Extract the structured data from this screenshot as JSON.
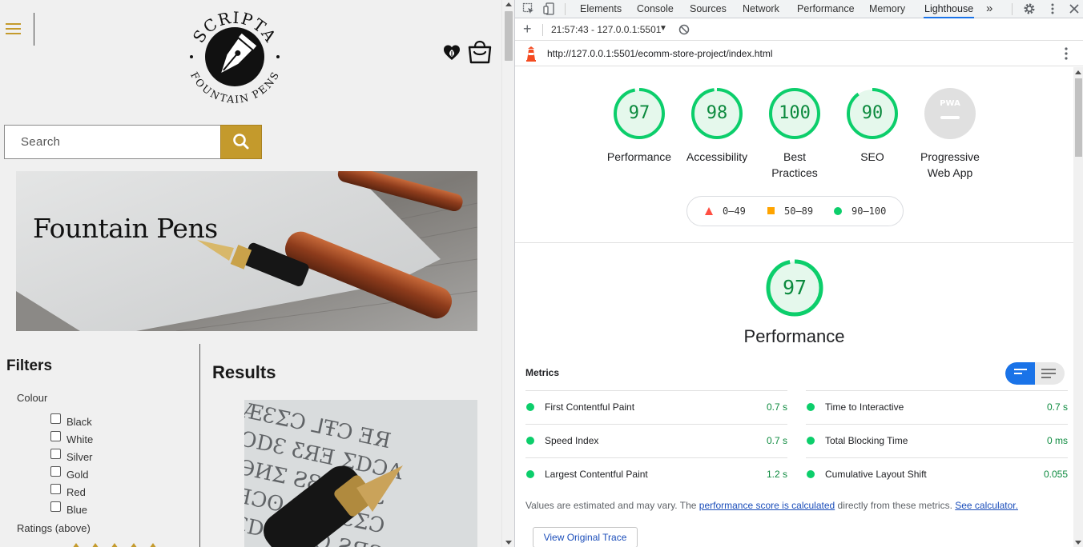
{
  "site": {
    "logo": {
      "top_text": "SCRIPTA",
      "bottom_text": "FOUNTAIN PENS"
    },
    "search": {
      "placeholder": "Search"
    },
    "hero": {
      "title": "Fountain Pens"
    },
    "filters": {
      "title": "Filters",
      "colour_label": "Colour",
      "colours": [
        "Black",
        "White",
        "Silver",
        "Gold",
        "Red",
        "Blue"
      ],
      "ratings_label": "Ratings (above)"
    },
    "results": {
      "title": "Results"
    },
    "colors": {
      "accent": "#c49a2c",
      "background": "#f0f0f0"
    }
  },
  "devtools": {
    "tabs": [
      "Elements",
      "Console",
      "Sources",
      "Network",
      "Performance",
      "Memory",
      "Lighthouse"
    ],
    "active_tab": "Lighthouse",
    "more_tabs": "»",
    "report_selector": "21:57:43 - 127.0.0.1:5501",
    "url": "http://127.0.0.1:5501/ecomm-store-project/index.html",
    "lighthouse": {
      "scores": [
        {
          "label": "Performance",
          "value": "97",
          "score": 97
        },
        {
          "label": "Accessibility",
          "value": "98",
          "score": 98
        },
        {
          "label": "Best Practices",
          "value": "100",
          "score": 100
        },
        {
          "label": "SEO",
          "value": "90",
          "score": 90
        }
      ],
      "pwa": {
        "label": "Progressive Web App",
        "badge": "PWA"
      },
      "legend": [
        {
          "range": "0–49",
          "shape": "triangle",
          "color": "#ff4e42"
        },
        {
          "range": "50–89",
          "shape": "square",
          "color": "#ffa400"
        },
        {
          "range": "90–100",
          "shape": "circle",
          "color": "#0cce6b"
        }
      ],
      "performance": {
        "score": "97",
        "title": "Performance",
        "metrics_title": "Metrics",
        "metrics": [
          {
            "name": "First Contentful Paint",
            "value": "0.7 s"
          },
          {
            "name": "Time to Interactive",
            "value": "0.7 s"
          },
          {
            "name": "Speed Index",
            "value": "0.7 s"
          },
          {
            "name": "Total Blocking Time",
            "value": "0 ms"
          },
          {
            "name": "Largest Contentful Paint",
            "value": "1.2 s"
          },
          {
            "name": "Cumulative Layout Shift",
            "value": "0.055"
          }
        ],
        "note_prefix": "Values are estimated and may vary. The ",
        "note_link1": "performance score is calculated",
        "note_middle": " directly from these metrics. ",
        "note_link2": "See calculator.",
        "trace_button": "View Original Trace"
      }
    },
    "colors": {
      "pass": "#0cce6b",
      "pass_text": "#0c8a3e",
      "active_tab": "#1a73e8"
    }
  }
}
